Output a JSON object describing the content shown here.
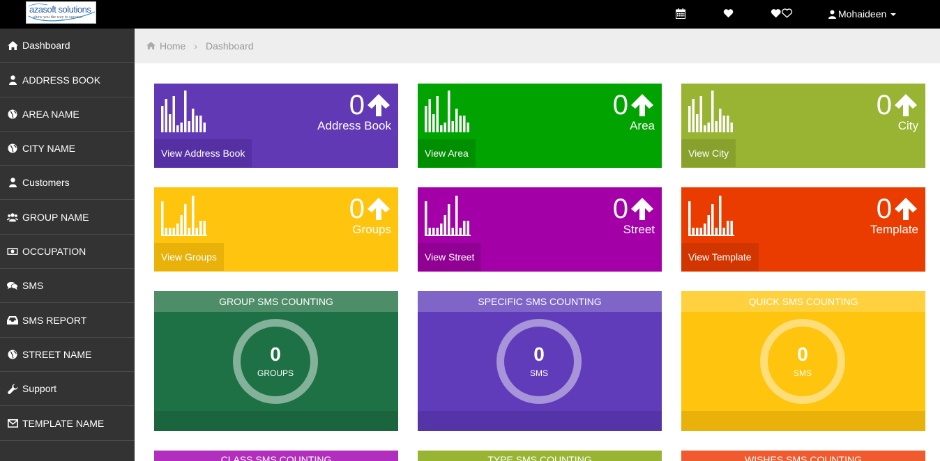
{
  "header": {
    "logo_text": "azasoft solutions",
    "logo_tagline": "show you the way to success",
    "icons": [
      "calendar-icon",
      "heart-icon",
      "hearts-icon"
    ],
    "user_name": "Mohaideen"
  },
  "sidebar": {
    "items": [
      {
        "label": "Dashboard",
        "icon": "home-icon"
      },
      {
        "label": "ADDRESS BOOK",
        "icon": "user-icon"
      },
      {
        "label": "AREA NAME",
        "icon": "globe-icon"
      },
      {
        "label": "CITY NAME",
        "icon": "globe-icon"
      },
      {
        "label": "Customers",
        "icon": "user-icon"
      },
      {
        "label": "GROUP NAME",
        "icon": "users-icon"
      },
      {
        "label": "OCCUPATION",
        "icon": "money-icon"
      },
      {
        "label": "SMS",
        "icon": "comments-icon"
      },
      {
        "label": "SMS REPORT",
        "icon": "inbox-icon"
      },
      {
        "label": "STREET NAME",
        "icon": "globe-icon"
      },
      {
        "label": "Support",
        "icon": "wrench-icon"
      },
      {
        "label": "TEMPLATE NAME",
        "icon": "envelope-icon"
      }
    ]
  },
  "breadcrumb": {
    "home": "Home",
    "current": "Dashboard"
  },
  "stats": [
    {
      "value": "0",
      "label": "Address Book",
      "link": "View Address Book",
      "color": "#6139b5",
      "foot_color": "#5530a3"
    },
    {
      "value": "0",
      "label": "Area",
      "link": "View Area",
      "color": "#00a300",
      "foot_color": "#008f00"
    },
    {
      "value": "0",
      "label": "City",
      "link": "View City",
      "color": "#99b433",
      "foot_color": "#88a12c"
    },
    {
      "value": "0",
      "label": "Groups",
      "link": "View Groups",
      "color": "#ffc40d",
      "foot_color": "#e8b20b"
    },
    {
      "value": "0",
      "label": "Street",
      "link": "View Street",
      "color": "#a300a8",
      "foot_color": "#8f0093"
    },
    {
      "value": "0",
      "label": "Template",
      "link": "View Template",
      "color": "#eb3c00",
      "foot_color": "#d23600"
    }
  ],
  "panels": [
    {
      "title": "GROUP SMS COUNTING",
      "value": "0",
      "unit": "GROUPS",
      "color": "#1e7145",
      "head_color": "#4d8d68",
      "foot_color": "#1b653e",
      "ring_color": "rgba(255,255,255,0.45)"
    },
    {
      "title": "SPECIFIC SMS COUNTING",
      "value": "0",
      "unit": "SMS",
      "color": "#603cba",
      "head_color": "#8065c8",
      "foot_color": "#5534a8",
      "ring_color": "rgba(255,255,255,0.45)"
    },
    {
      "title": "QUICK SMS COUNTING",
      "value": "0",
      "unit": "SMS",
      "color": "#ffc40d",
      "head_color": "#ffd13f",
      "foot_color": "#e8b20b",
      "ring_color": "rgba(255,255,255,0.45)"
    }
  ],
  "partial_panels": [
    {
      "title": "CLASS SMS COUNTING",
      "color": "#b12fbc"
    },
    {
      "title": "TYPE SMS COUNTING",
      "color": "#99b433"
    },
    {
      "title": "WISHES SMS COUNTING",
      "color": "#ef5a2f"
    }
  ]
}
